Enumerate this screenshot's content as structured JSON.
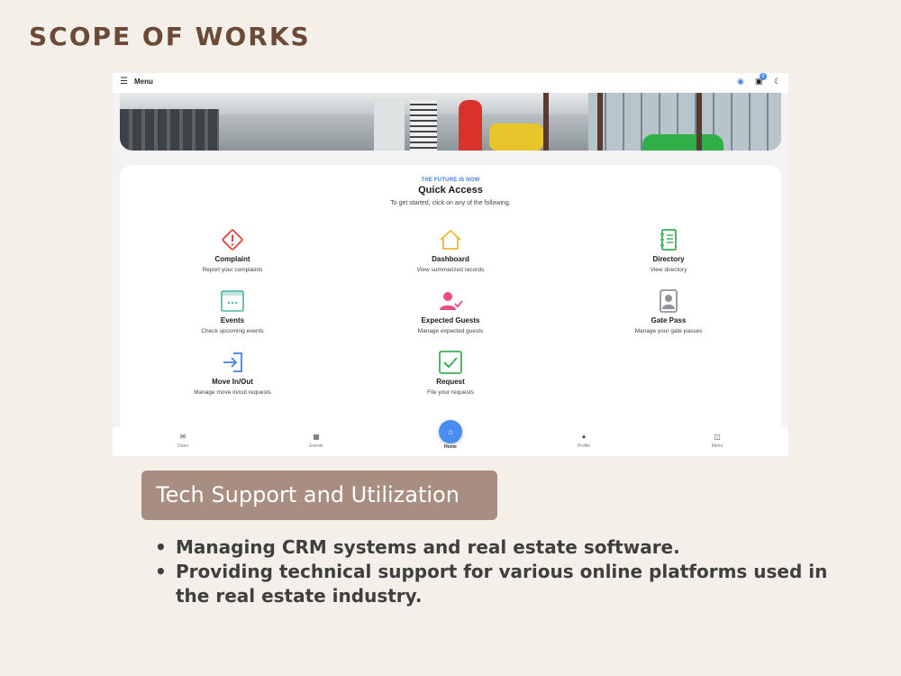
{
  "slide": {
    "title": "SCOPE OF WORKS",
    "section_label": "Tech Support and Utilization",
    "bullets": [
      "Managing CRM systems and real estate software.",
      "Providing technical support for various online platforms used in the real estate industry."
    ]
  },
  "app": {
    "topbar": {
      "menu_label": "Menu",
      "cart_badge": "0"
    },
    "quick_access": {
      "kicker": "THE FUTURE IS NOW",
      "title": "Quick Access",
      "subtitle": "To get started, click on any of the following.",
      "tiles": [
        {
          "name": "Complaint",
          "desc": "Report your complaints",
          "icon": "warning-diamond-icon",
          "color": "#e0463f"
        },
        {
          "name": "Dashboard",
          "desc": "View summarized records",
          "icon": "home-outline-icon",
          "color": "#e9b93a"
        },
        {
          "name": "Directory",
          "desc": "View directory",
          "icon": "notebook-icon",
          "color": "#3fae5a"
        },
        {
          "name": "Events",
          "desc": "Check upcoming events",
          "icon": "calendar-icon",
          "color": "#4bb3a3"
        },
        {
          "name": "Expected Guests",
          "desc": "Manage expected guests",
          "icon": "user-check-icon",
          "color": "#ea4f7b"
        },
        {
          "name": "Gate Pass",
          "desc": "Manage your gate passes",
          "icon": "id-badge-icon",
          "color": "#8f9499"
        },
        {
          "name": "Move In/Out",
          "desc": "Manage move in/out requests",
          "icon": "sign-in-icon",
          "color": "#3f83e6"
        },
        {
          "name": "Request",
          "desc": "File your requests",
          "icon": "checkbox-icon",
          "color": "#3fae5a"
        }
      ]
    },
    "bottom_nav": [
      {
        "label": "Dues",
        "icon": "envelope-icon"
      },
      {
        "label": "Events",
        "icon": "calendar-icon"
      },
      {
        "label": "Home",
        "icon": "home-icon"
      },
      {
        "label": "Profile",
        "icon": "person-icon"
      },
      {
        "label": "Menu",
        "icon": "sidebar-icon"
      }
    ]
  }
}
